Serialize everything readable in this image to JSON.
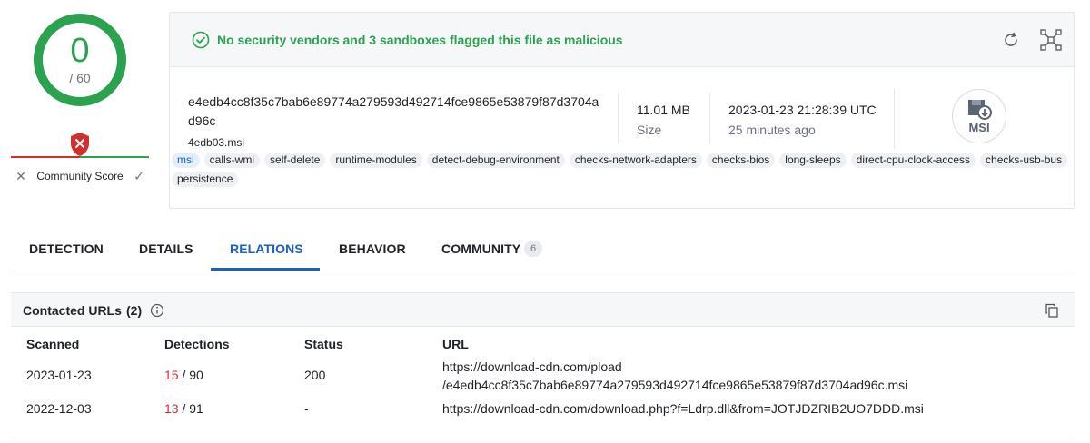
{
  "score": {
    "detections": "0",
    "total": "/ 60",
    "ring_color": "#2ba24f"
  },
  "community": {
    "label": "Community Score",
    "dismiss_symbol": "✕",
    "approve_symbol": "✓"
  },
  "summary": {
    "verdict": "No security vendors and 3 sandboxes flagged this file as malicious",
    "hash": "e4edb4cc8f35c7bab6e89774a279593d492714fce9865e53879f87d3704ad96c",
    "filename": "4edb03.msi",
    "size_value": "11.01 MB",
    "size_label": "Size",
    "date_value": "2023-01-23 21:28:39 UTC",
    "date_ago": "25 minutes ago",
    "file_type": "MSI",
    "tags": [
      "msi",
      "calls-wmi",
      "self-delete",
      "runtime-modules",
      "detect-debug-environment",
      "checks-network-adapters",
      "checks-bios",
      "long-sleeps",
      "direct-cpu-clock-access",
      "checks-usb-bus",
      "persistence"
    ]
  },
  "tabs": [
    {
      "label": "DETECTION"
    },
    {
      "label": "DETAILS"
    },
    {
      "label": "RELATIONS",
      "active": true
    },
    {
      "label": "BEHAVIOR"
    },
    {
      "label": "COMMUNITY",
      "count": "6"
    }
  ],
  "contacted_urls": {
    "title": "Contacted URLs",
    "count": "(2)",
    "columns": [
      "Scanned",
      "Detections",
      "Status",
      "URL"
    ],
    "rows": [
      {
        "scanned": "2023-01-23",
        "det_hits": "15",
        "det_total": " / 90",
        "status": "200",
        "url_line1": "https://download-cdn.com/pload",
        "url_line2": "/e4edb4cc8f35c7bab6e89774a279593d492714fce9865e53879f87d3704ad96c.msi"
      },
      {
        "scanned": "2022-12-03",
        "det_hits": "13",
        "det_total": " / 91",
        "status": "-",
        "url_line1": "https://download-cdn.com/download.php?f=Ldrp.dll&from=JOTJDZRIB2UO7DDD.msi",
        "url_line2": ""
      }
    ]
  },
  "colors": {
    "accent": "#1d5fc2",
    "ok": "#2ba24f",
    "danger": "#d12f2f"
  }
}
